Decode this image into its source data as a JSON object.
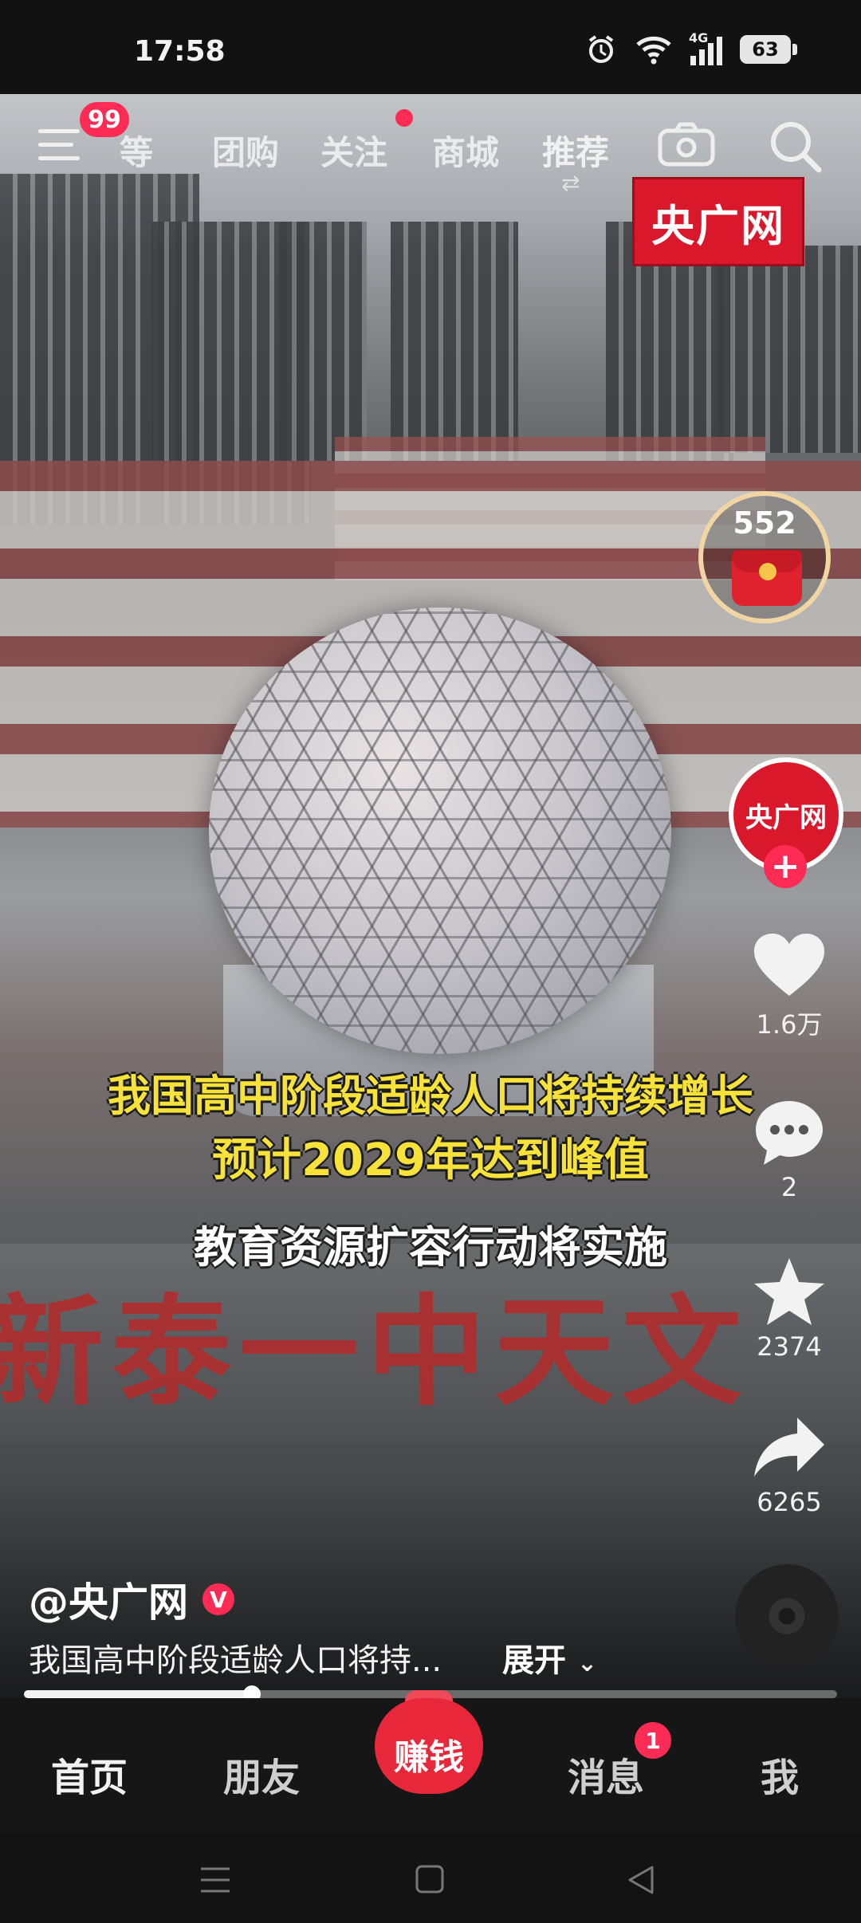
{
  "status_bar": {
    "time": "17:58",
    "network": "4G",
    "battery": "63"
  },
  "top_nav": {
    "menu_badge": "99",
    "tabs": [
      {
        "label": "等"
      },
      {
        "label": "团购"
      },
      {
        "label": "关注",
        "has_dot": true
      },
      {
        "label": "商城"
      },
      {
        "label": "推荐"
      }
    ]
  },
  "video": {
    "watermark": "央广网",
    "sign_text": "新泰一中天文",
    "captions": [
      "我国高中阶段适龄人口将持续增长",
      "预计2029年达到峰值",
      "教育资源扩容行动将实施"
    ]
  },
  "right_rail": {
    "red_packet_count": "552",
    "avatar_text": "央广网",
    "likes": "1.6万",
    "comments": "2",
    "favorites": "2374",
    "shares": "6265"
  },
  "post": {
    "author": "@央广网",
    "verified_mark": "V",
    "description": "我国高中阶段适龄人口将持...",
    "expand_label": "展开",
    "progress": 0.28
  },
  "bottom_tabs": {
    "home": "首页",
    "friends": "朋友",
    "earn": "赚钱",
    "messages": "消息",
    "messages_badge": "1",
    "me": "我"
  },
  "colors": {
    "accent": "#fe2c55",
    "caption_yellow": "#f7e23a",
    "brand_red": "#d9182b"
  }
}
